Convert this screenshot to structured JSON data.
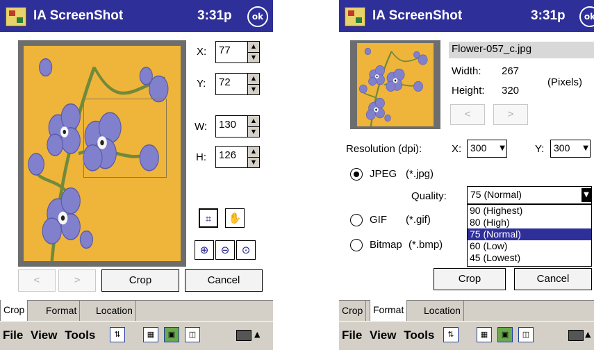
{
  "app": {
    "title": "IA ScreenShot",
    "time": "3:31p",
    "ok_label": "ok"
  },
  "left": {
    "fields": {
      "x": {
        "label": "X:",
        "value": "77"
      },
      "y": {
        "label": "Y:",
        "value": "72"
      },
      "w": {
        "label": "W:",
        "value": "130"
      },
      "h": {
        "label": "H:",
        "value": "126"
      }
    },
    "buttons": {
      "prev": "<",
      "next": ">",
      "crop": "Crop",
      "cancel": "Cancel"
    },
    "tool_icons": [
      "crop-tool-icon",
      "hand-tool-icon",
      "zoom-in-icon",
      "zoom-out-icon",
      "zoom-fit-icon"
    ],
    "tabs": [
      "Crop",
      "Format",
      "Location"
    ],
    "active_tab": "Crop"
  },
  "right": {
    "filename": "Flower-057_c.jpg",
    "width_label": "Width:",
    "width_value": "267",
    "height_label": "Height:",
    "height_value": "320",
    "units": "(Pixels)",
    "nav": {
      "prev": "<",
      "next": ">"
    },
    "resolution_label": "Resolution (dpi):",
    "res_x_label": "X:",
    "res_x_value": "300",
    "res_y_label": "Y:",
    "res_y_value": "300",
    "formats": [
      {
        "name": "JPEG",
        "ext": "(*.jpg)",
        "selected": true
      },
      {
        "name": "GIF",
        "ext": "(*.gif)",
        "selected": false
      },
      {
        "name": "Bitmap",
        "ext": "(*.bmp)",
        "selected": false
      }
    ],
    "quality_label": "Quality:",
    "quality_value": "75 (Normal)",
    "quality_options": [
      "90 (Highest)",
      "80 (High)",
      "75 (Normal)",
      "60 (Low)",
      "45 (Lowest)"
    ],
    "buttons": {
      "crop": "Crop",
      "cancel": "Cancel"
    },
    "tabs": [
      "Crop",
      "Format",
      "Location"
    ],
    "active_tab": "Format"
  },
  "menubar": {
    "items": [
      "File",
      "View",
      "Tools"
    ]
  },
  "colors": {
    "titlebar": "#2f2f9a",
    "selection": "#2f2f9a",
    "chrome": "#d4d0c8"
  }
}
